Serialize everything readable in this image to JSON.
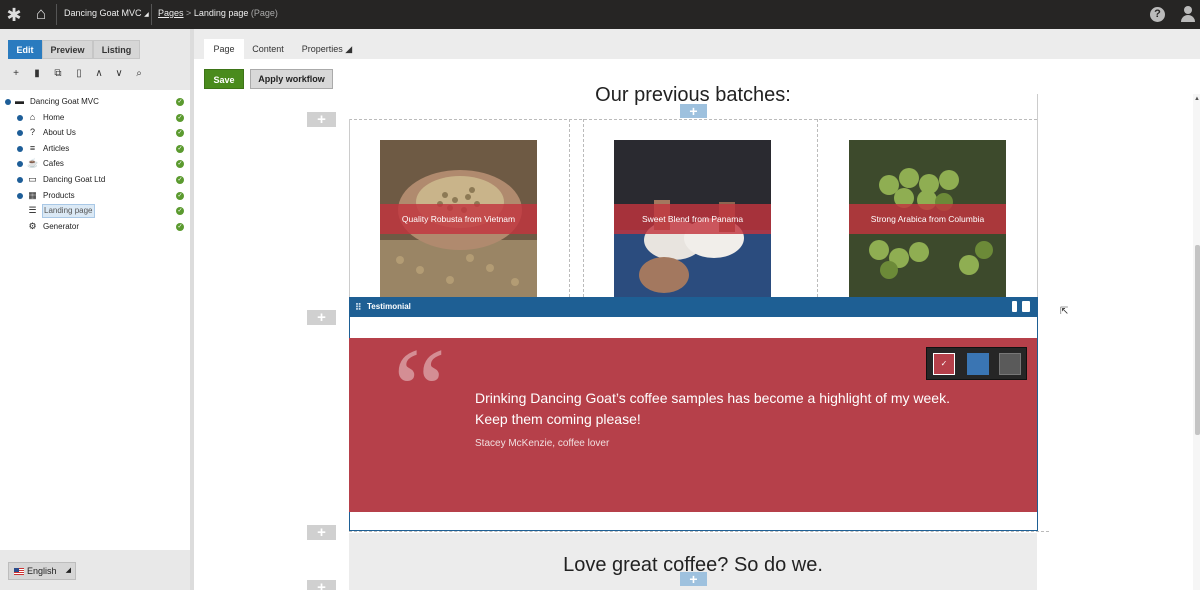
{
  "topbar": {
    "site_name": "Dancing Goat MVC",
    "site_caret": "◢",
    "breadcrumb_root": "Pages",
    "breadcrumb_sep": ">",
    "breadcrumb_page": "Landing page",
    "breadcrumb_type": "(Page)",
    "help_icon": "question-circle-icon",
    "user_icon": "user-icon"
  },
  "modes": [
    "Edit",
    "Preview",
    "Listing"
  ],
  "tree_tools": [
    "+",
    "▮",
    "⧉",
    "▯",
    "∧",
    "∨",
    "⌕"
  ],
  "tree": {
    "root": "Dancing Goat MVC",
    "items": [
      {
        "label": "Home",
        "icon": "⌂"
      },
      {
        "label": "About Us",
        "icon": "?"
      },
      {
        "label": "Articles",
        "icon": "≡"
      },
      {
        "label": "Cafes",
        "icon": "☕"
      },
      {
        "label": "Dancing Goat Ltd",
        "icon": "▭"
      },
      {
        "label": "Products",
        "icon": "▦"
      },
      {
        "label": "Landing page",
        "icon": "☰"
      },
      {
        "label": "Generator",
        "icon": "⚙"
      }
    ],
    "check": "✓"
  },
  "language": {
    "label": "English",
    "caret": "◢"
  },
  "page_tabs": [
    "Page",
    "Content",
    "Properties ◢"
  ],
  "actions": {
    "save": "Save",
    "workflow": "Apply workflow"
  },
  "plus": "+",
  "batches": {
    "title": "Our previous batches:",
    "cards": [
      {
        "caption": "Quality Robusta from Vietnam",
        "image": "coffee-beans-hands-photo"
      },
      {
        "caption": "Sweet Blend from Panama",
        "image": "coffee-cups-toast-photo"
      },
      {
        "caption": "Strong Arabica from Columbia",
        "image": "coffee-cherries-photo"
      }
    ]
  },
  "widget": {
    "name": "Testimonial",
    "grip": "⠿"
  },
  "testimonial": {
    "quote_mark": "“",
    "line1": "Drinking Dancing Goat’s coffee samples has become a highlight of my week.",
    "line2": "Keep them coming please!",
    "author": "Stacey McKenzie, coffee lover",
    "colors": [
      "#b6404a",
      "#3a75b3",
      "#5a5a5a"
    ],
    "selected_mark": "✓"
  },
  "love": {
    "title": "Love great coffee? So do we."
  },
  "cursor": "⇱"
}
